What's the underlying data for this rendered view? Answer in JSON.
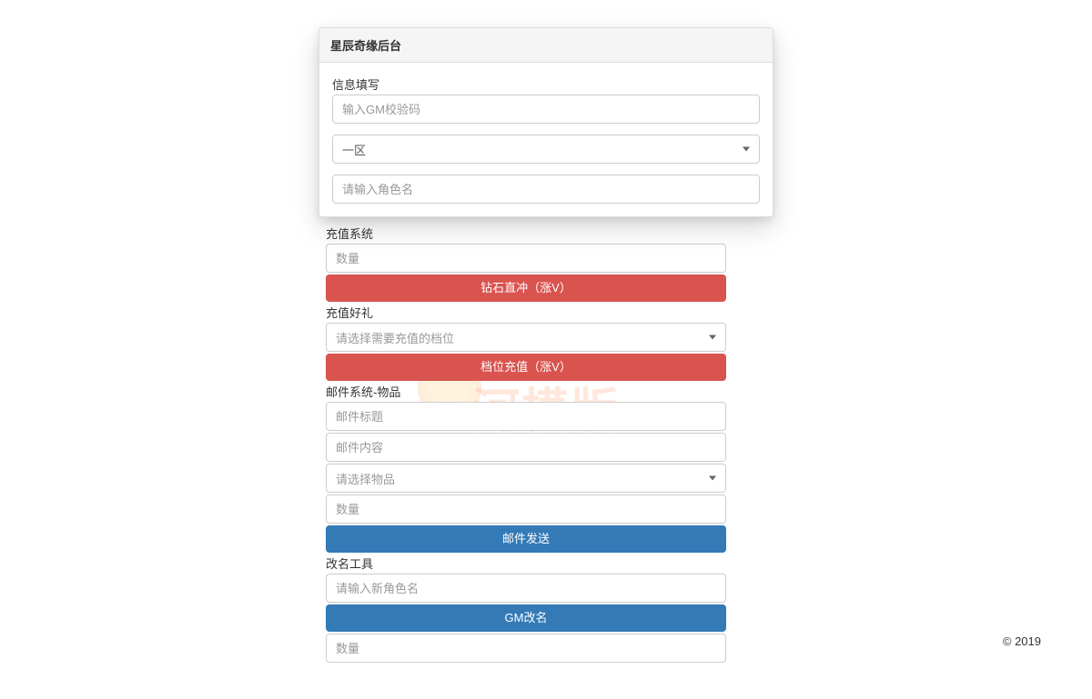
{
  "panel": {
    "title": "星辰奇缘后台"
  },
  "info": {
    "label": "信息填写",
    "gm_code_placeholder": "输入GM校验码",
    "region_selected": "一区",
    "role_placeholder": "请输入角色名"
  },
  "recharge": {
    "label": "充值系统",
    "qty_placeholder": "数量",
    "diamond_button": "钻石直冲（涨V）"
  },
  "gift": {
    "label": "充值好礼",
    "tier_placeholder": "请选择需要充值的档位",
    "tier_button": "档位充值（涨V）"
  },
  "mail": {
    "label": "邮件系统-物品",
    "title_placeholder": "邮件标题",
    "content_placeholder": "邮件内容",
    "item_placeholder": "请选择物品",
    "qty_placeholder": "数量",
    "send_button": "邮件发送"
  },
  "rename": {
    "label": "改名工具",
    "new_name_placeholder": "请输入新角色名",
    "button": "GM改名",
    "qty_placeholder": "数量"
  },
  "footer": "© 2019",
  "watermark": "河模版"
}
